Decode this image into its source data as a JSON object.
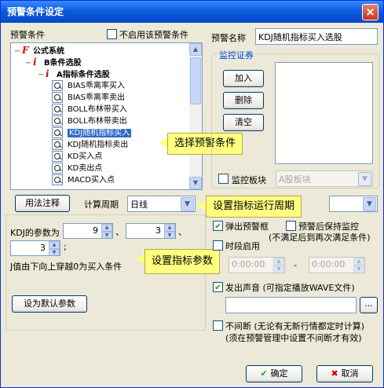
{
  "window": {
    "title": "预警条件设定",
    "close": "×"
  },
  "left": {
    "section_label": "预警条件",
    "disable_checkbox": {
      "label": "不启用该预警条件",
      "checked": false
    },
    "tree": [
      {
        "prefix": "F",
        "text": "公式系统",
        "level": 0,
        "bold": true
      },
      {
        "prefix": "i",
        "text": "B条件选股",
        "level": 1,
        "bold": true
      },
      {
        "prefix": "i",
        "text": "A指标条件选股",
        "level": 2,
        "bold": true
      },
      {
        "icon": "magnifier-icon",
        "text": "BIAS乖离率买入",
        "level": 3
      },
      {
        "icon": "magnifier-icon",
        "text": "BIAS乖离率卖出",
        "level": 3
      },
      {
        "icon": "magnifier-icon",
        "text": "BOLL布林带买入",
        "level": 3
      },
      {
        "icon": "magnifier-icon",
        "text": "BOLL布林带卖出",
        "level": 3
      },
      {
        "icon": "magnifier-icon",
        "text": "KDJ随机指标买入",
        "level": 3,
        "selected": true
      },
      {
        "icon": "magnifier-icon",
        "text": "KDJ随机指标卖出",
        "level": 3
      },
      {
        "icon": "magnifier-icon",
        "text": "KD买入点",
        "level": 3
      },
      {
        "icon": "magnifier-icon",
        "text": "KD卖出点",
        "level": 3
      },
      {
        "icon": "magnifier-icon",
        "text": "MACD买入点",
        "level": 3
      }
    ],
    "usage_button": "用法注释",
    "period_label": "计算周期",
    "period_value": "日线",
    "params_label": "KDJ的参数为",
    "param1": "9",
    "param2": "3",
    "param3": "3",
    "sep1": "、",
    "sep2": "、",
    "sep3": ";",
    "description": "J值由下向上穿越0为买入条件",
    "default_button": "设为默认参数"
  },
  "right": {
    "name_label": "预警名称",
    "name_value": "KDJ随机指标买入选股",
    "monitor_group_title": "监控证券",
    "add_button": "加入",
    "delete_button": "删除",
    "clear_button": "清空",
    "board_checkbox": {
      "label": "监控板块",
      "checked": false
    },
    "board_value": "A股板块",
    "popup_checkbox": {
      "label": "弹出预警框",
      "checked": true
    },
    "keep_checkbox": {
      "label": "预警后保持监控",
      "checked": false
    },
    "keep_note": "(不满足后到再次满足条件)",
    "period_enable_checkbox": {
      "label": "时段启用",
      "checked": false
    },
    "time_start": "0:00:00",
    "time_dash": "-",
    "time_end": "0:00:00",
    "sound_checkbox": {
      "label": "发出声音 (可指定播放WAVE文件)",
      "checked": true
    },
    "browse_button": "...",
    "nonstop_checkbox": {
      "label": "不间断 (无论有无新行情都定时计算)",
      "checked": false
    },
    "nonstop_note": "(须在预警管理中设置不间断才有效)",
    "ok_button": "确定",
    "cancel_button": "取消"
  },
  "callouts": {
    "select_condition": "选择预警条件",
    "set_period": "设置指标运行周期",
    "set_params": "设置指标参数"
  },
  "colors": {
    "titlebar": "#0A5BE0",
    "callout_bg": "#FFFF80",
    "selected": "#316AC5",
    "formula_red": "#E00000"
  }
}
